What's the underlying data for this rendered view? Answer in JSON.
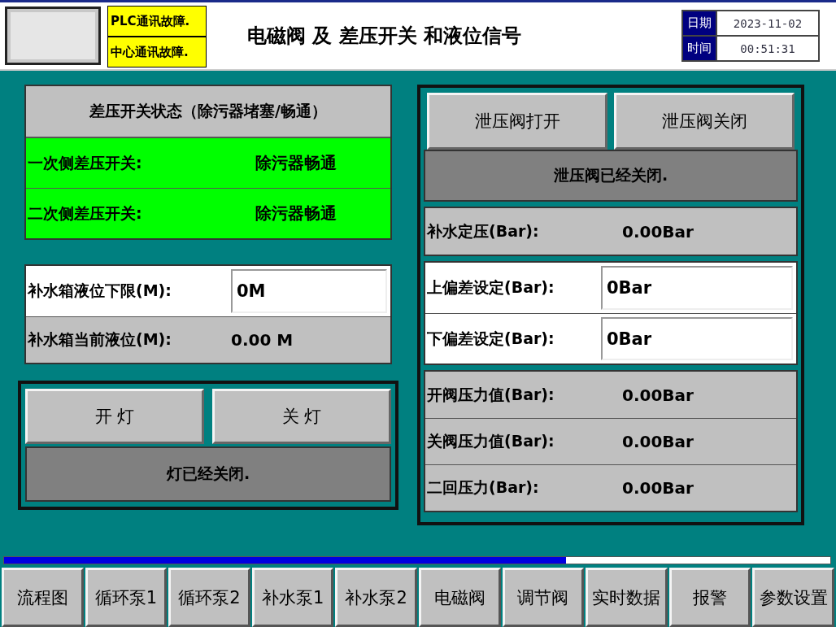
{
  "header": {
    "status_badges": [
      "PLC通讯故障.",
      "中心通讯故障."
    ],
    "title": "电磁阀 及 差压开关 和液位信号",
    "date_label": "日期",
    "date": "2023-11-02",
    "time_label": "时间",
    "time": "00:51:31"
  },
  "dp_switch": {
    "heading": "差压开关状态（除污器堵塞/畅通）",
    "rows": [
      {
        "label": "一次侧差压开关:",
        "value": "除污器畅通",
        "alarm": false
      },
      {
        "label": "二次侧差压开关:",
        "value": "除污器畅通",
        "alarm": false
      }
    ]
  },
  "tank": {
    "rows": [
      {
        "kind": "input",
        "label": "补水箱液位下限(M):",
        "value": "0M"
      },
      {
        "kind": "readout",
        "label": "补水箱当前液位(M):",
        "value": "0.00 M"
      }
    ]
  },
  "light": {
    "buttons": [
      "开 灯",
      "关 灯"
    ],
    "status": "灯已经关闭."
  },
  "relief": {
    "buttons": [
      "泄压阀打开",
      "泄压阀关闭"
    ],
    "status": "泄压阀已经关闭.",
    "rows": [
      {
        "kind": "readout",
        "label": "补水定压(Bar):",
        "value": "0.00Bar"
      },
      {
        "kind": "input",
        "label": "上偏差设定(Bar):",
        "value": "0Bar"
      },
      {
        "kind": "input",
        "label": "下偏差设定(Bar):",
        "value": "0Bar"
      },
      {
        "kind": "readout",
        "label": "开阀压力值(Bar):",
        "value": "0.00Bar"
      },
      {
        "kind": "readout",
        "label": "关阀压力值(Bar):",
        "value": "0.00Bar"
      },
      {
        "kind": "readout",
        "label": "二回压力(Bar):",
        "value": "0.00Bar"
      }
    ]
  },
  "progress": {
    "level": 0.68
  },
  "nav": [
    "流程图",
    "循环泵1",
    "循环泵2",
    "补水泵1",
    "补水泵2",
    "电磁阀",
    "调节阀",
    "实时数据",
    "报警",
    "参数设置"
  ]
}
